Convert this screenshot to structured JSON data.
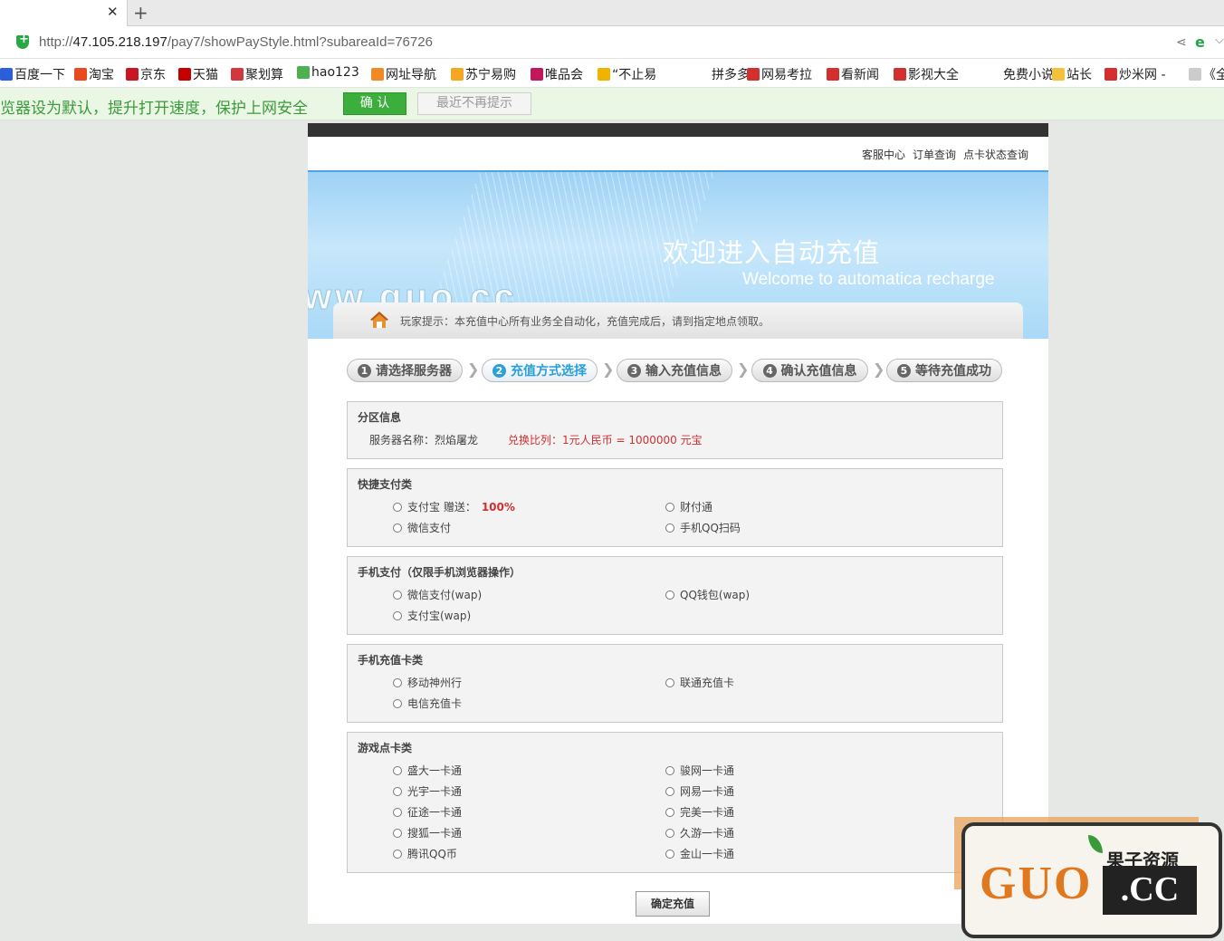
{
  "browser": {
    "url_prefix": "http://",
    "url_host": "47.105.218.197",
    "url_path": "/pay7/showPayStyle.html?subareaId=76726",
    "bookmarks": [
      {
        "label": "百度一下",
        "icon": "baidu-icon",
        "color": "#2b5fd9"
      },
      {
        "label": "淘宝",
        "icon": "taobao-icon",
        "color": "#e8491d"
      },
      {
        "label": "京东",
        "icon": "jd-icon",
        "color": "#c81623"
      },
      {
        "label": "天猫",
        "icon": "tmall-icon",
        "color": "#c40000"
      },
      {
        "label": "聚划算",
        "icon": "juhuasuan-icon",
        "color": "#d2373e"
      },
      {
        "label": "hao123",
        "icon": "hao123-icon",
        "color": "#4caf50"
      },
      {
        "label": "网址导航",
        "icon": "nav-7654-icon",
        "color": "#f08a24"
      },
      {
        "label": "苏宁易购",
        "icon": "suning-icon",
        "color": "#f5a623"
      },
      {
        "label": "唯品会",
        "icon": "vip-icon",
        "color": "#c2185b"
      },
      {
        "label": "“不止易",
        "icon": "fire-icon",
        "color": "#f0b400"
      },
      {
        "label": "拼多多",
        "icon": "pinduoduo-icon",
        "color": "#ffffff"
      },
      {
        "label": "网易考拉",
        "icon": "kaola-icon",
        "color": "#d32f2f"
      },
      {
        "label": "看新闻",
        "icon": "news-icon",
        "color": "#d32f2f"
      },
      {
        "label": "影视大全",
        "icon": "play-icon",
        "color": "#d32f2f"
      },
      {
        "label": "免费小说",
        "icon": "book-icon",
        "color": "#ffffff"
      },
      {
        "label": "站长",
        "icon": "folder-icon",
        "color": "#f3c13a"
      },
      {
        "label": "炒米网 -",
        "icon": "chart-icon",
        "color": "#d32f2f"
      },
      {
        "label": "《全",
        "icon": "doc-icon",
        "color": "#cccccc"
      }
    ],
    "notice_text": "览器设为默认，提升打开速度，保护上网安全",
    "notice_confirm": "确 认",
    "notice_dismiss": "最近不再提示"
  },
  "header": {
    "links": [
      "客服中心",
      "订单查询",
      "点卡状态查询"
    ]
  },
  "banner": {
    "title": "欢迎进入自动充值",
    "subtitle": "Welcome to automatica recharge",
    "watermark": "www.guo.cc",
    "tip": "玩家提示：本充值中心所有业务全自动化，充值完成后，请到指定地点领取。"
  },
  "steps": [
    {
      "num": "1",
      "label": "请选择服务器",
      "active": false
    },
    {
      "num": "2",
      "label": "充值方式选择",
      "active": true
    },
    {
      "num": "3",
      "label": "输入充值信息",
      "active": false
    },
    {
      "num": "4",
      "label": "确认充值信息",
      "active": false
    },
    {
      "num": "5",
      "label": "等待充值成功",
      "active": false
    }
  ],
  "info": {
    "title": "分区信息",
    "server": "服务器名称：烈焰屠龙",
    "ratio": "兑换比列：1元人民币 = 1000000 元宝"
  },
  "groups": [
    {
      "title": "快捷支付类",
      "options": [
        {
          "label": "支付宝 赠送：",
          "bonus": "100%"
        },
        {
          "label": "财付通"
        },
        {
          "label": "微信支付"
        },
        {
          "label": "手机QQ扫码"
        }
      ]
    },
    {
      "title": "手机支付（仅限手机浏览器操作）",
      "options": [
        {
          "label": "微信支付(wap)"
        },
        {
          "label": "QQ钱包(wap)"
        },
        {
          "label": "支付宝(wap)"
        }
      ]
    },
    {
      "title": "手机充值卡类",
      "options": [
        {
          "label": "移动神州行"
        },
        {
          "label": "联通充值卡"
        },
        {
          "label": "电信充值卡"
        }
      ]
    },
    {
      "title": "游戏点卡类",
      "options": [
        {
          "label": "盛大一卡通"
        },
        {
          "label": "骏网一卡通"
        },
        {
          "label": "光宇一卡通"
        },
        {
          "label": "网易一卡通"
        },
        {
          "label": "征途一卡通"
        },
        {
          "label": "完美一卡通"
        },
        {
          "label": "搜狐一卡通"
        },
        {
          "label": "久游一卡通"
        },
        {
          "label": "腾讯QQ币"
        },
        {
          "label": "金山一卡通"
        }
      ]
    }
  ],
  "submit_label": "确定充值",
  "corner_logo": {
    "big": "GUO",
    "cc": ".CC",
    "cn": "果子资源"
  },
  "colors": {
    "accent": "#2a9fd8",
    "alert": "#d03030",
    "notice_green": "#3cae3c"
  }
}
